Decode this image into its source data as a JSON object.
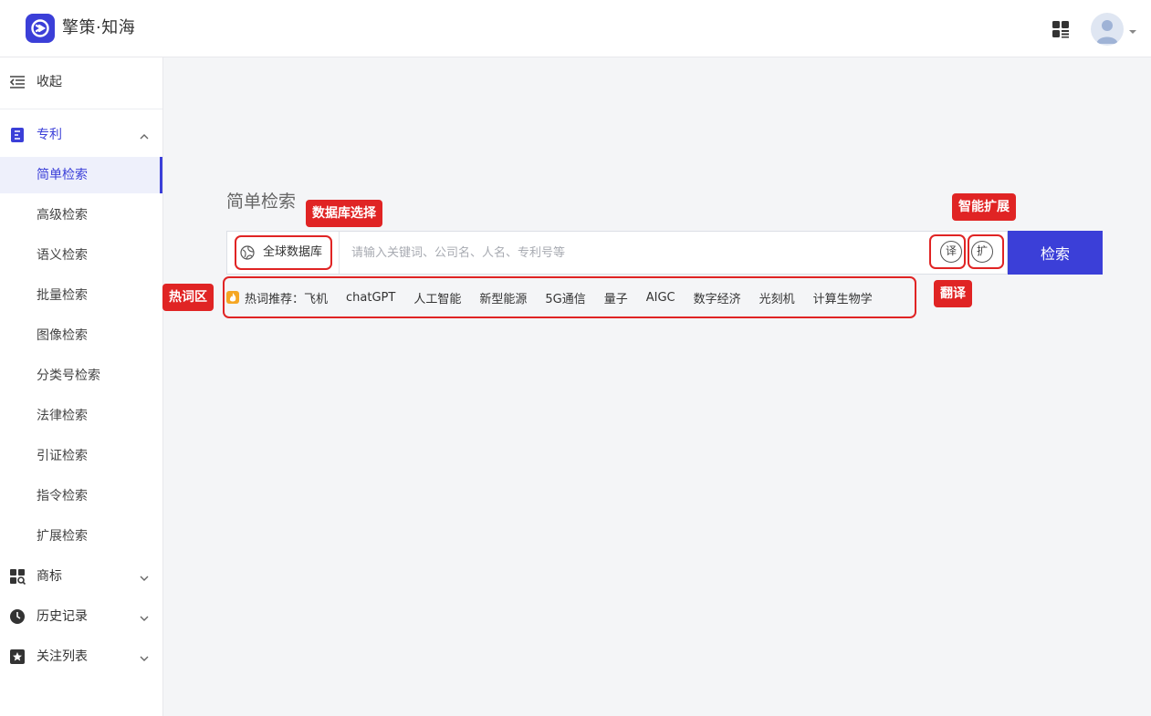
{
  "app": {
    "brand": "擎策·知海"
  },
  "sidebar": {
    "collapse_label": "收起",
    "patent_group": "专利",
    "items": [
      "简单检索",
      "高级检索",
      "语义检索",
      "批量检索",
      "图像检索",
      "分类号检索",
      "法律检索",
      "引证检索",
      "指令检索",
      "扩展检索"
    ],
    "trademark_group": "商标",
    "history_group": "历史记录",
    "watchlist_group": "关注列表"
  },
  "main": {
    "title": "简单检索",
    "database_select": "全球数据库",
    "search_placeholder": "请输入关键词、公司名、人名、专利号等",
    "translate_btn": "译",
    "expand_btn": "扩",
    "search_btn": "检索",
    "hot_label": "热词推荐：",
    "hot_words": [
      "飞机",
      "chatGPT",
      "人工智能",
      "新型能源",
      "5G通信",
      "量子",
      "AIGC",
      "数字经济",
      "光刻机",
      "计算生物学"
    ]
  },
  "annotations": {
    "database": "数据库选择",
    "smart_expand": "智能扩展",
    "translate": "翻译",
    "hotwords": "热词区"
  },
  "colors": {
    "accent": "#3b3fd8",
    "annotation": "#e02424",
    "hot_icon": "#f5a623"
  }
}
